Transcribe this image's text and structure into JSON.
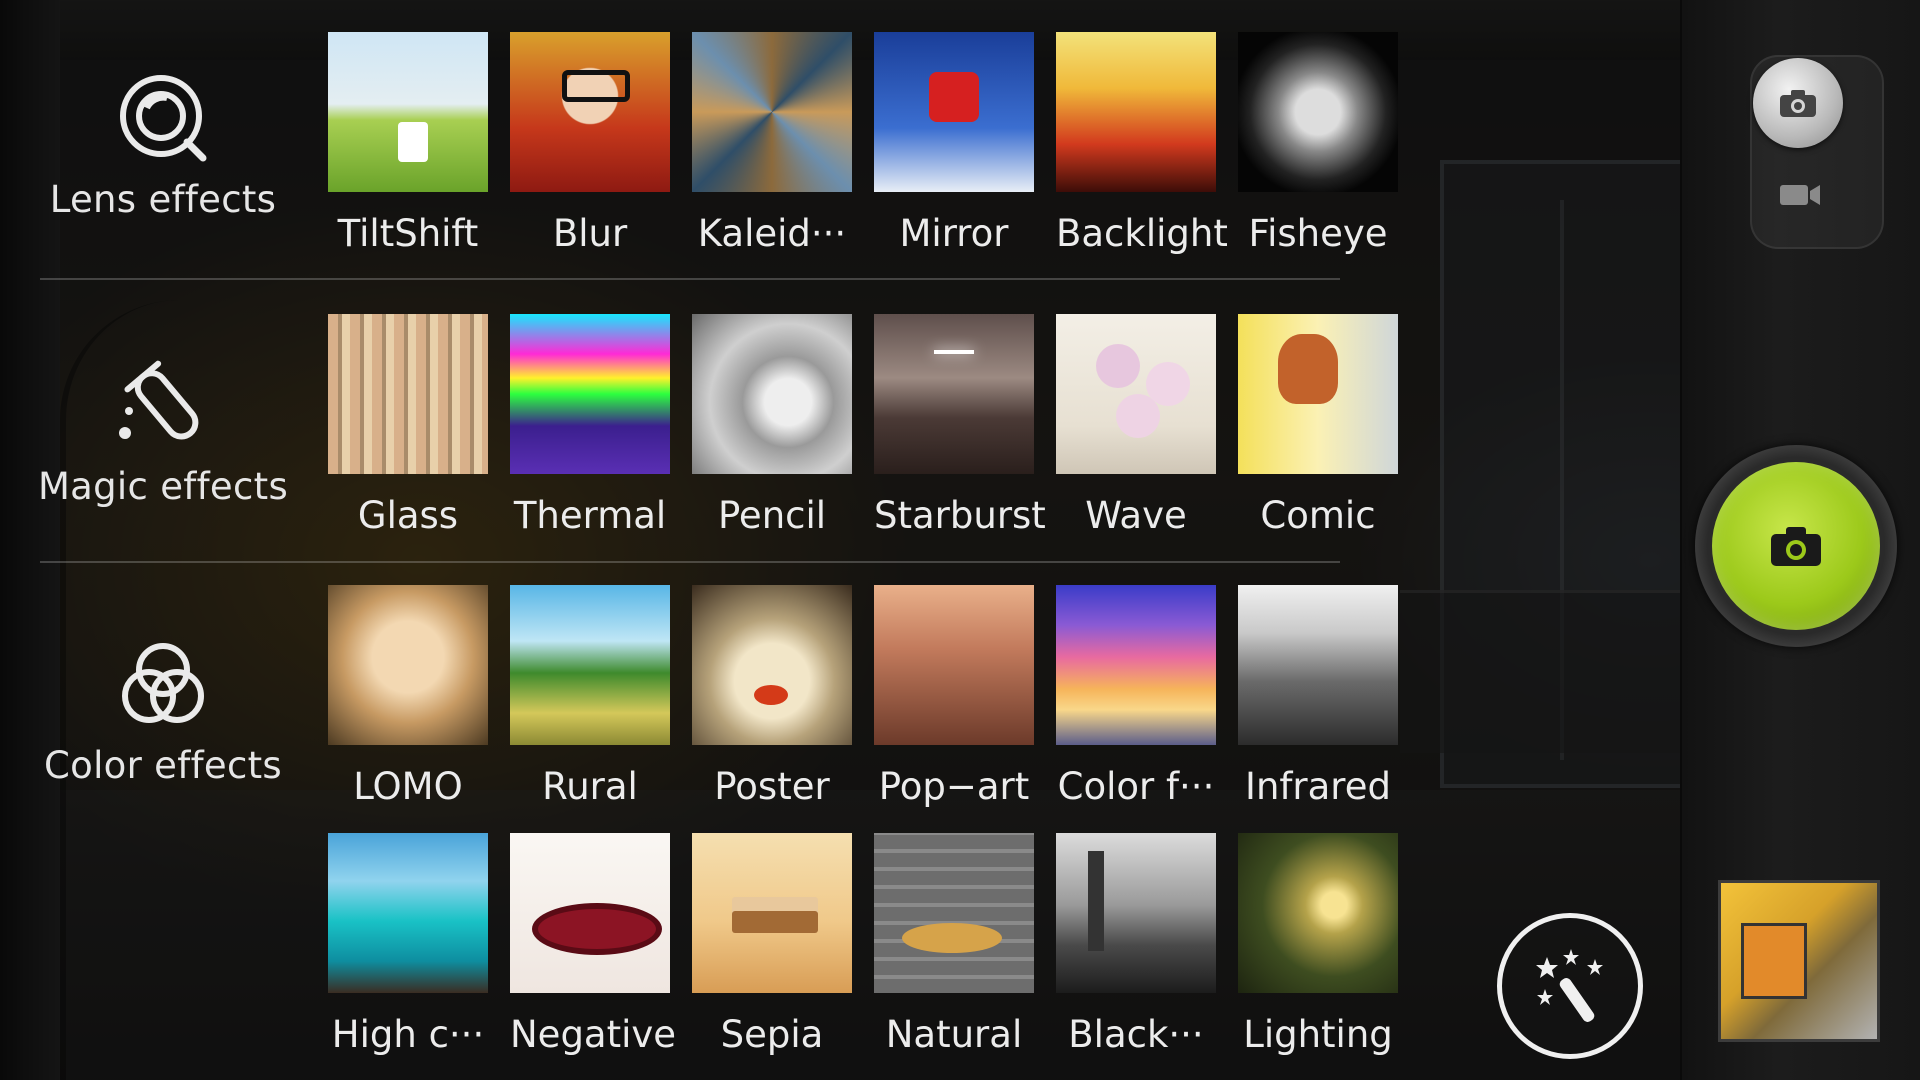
{
  "categories": [
    {
      "label": "Lens effects",
      "icon": "lens-effects-icon"
    },
    {
      "label": "Magic effects",
      "icon": "magic-effects-icon"
    },
    {
      "label": "Color effects",
      "icon": "color-effects-icon"
    }
  ],
  "effects": {
    "lens": [
      {
        "label": "TiltShift"
      },
      {
        "label": "Blur"
      },
      {
        "label": "Kaleid···"
      },
      {
        "label": "Mirror"
      },
      {
        "label": "Backlight"
      },
      {
        "label": "Fisheye"
      }
    ],
    "magic": [
      {
        "label": "Glass"
      },
      {
        "label": "Thermal"
      },
      {
        "label": "Pencil"
      },
      {
        "label": "Starburst"
      },
      {
        "label": "Wave"
      },
      {
        "label": "Comic"
      }
    ],
    "color_row1": [
      {
        "label": "LOMO"
      },
      {
        "label": "Rural"
      },
      {
        "label": "Poster"
      },
      {
        "label": "Pop−art"
      },
      {
        "label": "Color f···"
      },
      {
        "label": "Infrared"
      }
    ],
    "color_row2": [
      {
        "label": "High c···"
      },
      {
        "label": "Negative"
      },
      {
        "label": "Sepia"
      },
      {
        "label": "Natural"
      },
      {
        "label": "Black···"
      },
      {
        "label": "Lighting"
      }
    ]
  },
  "controls": {
    "photo_mode_icon": "camera-icon",
    "video_mode_icon": "video-camera-icon",
    "shutter_icon": "camera-icon",
    "magic_icon": "magic-wand-icon",
    "shutter_color": "#9cc91a"
  }
}
